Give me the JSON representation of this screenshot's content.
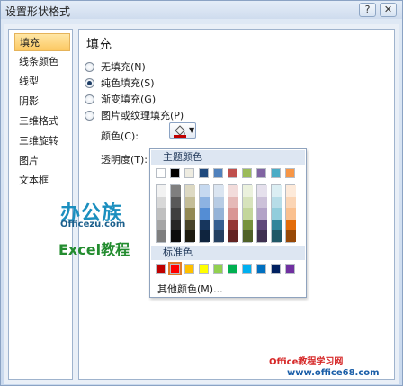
{
  "window": {
    "title": "设置形状格式",
    "help_icon": "?",
    "close_icon": "✕"
  },
  "nav": {
    "items": [
      {
        "label": "填充",
        "active": true
      },
      {
        "label": "线条颜色",
        "active": false
      },
      {
        "label": "线型",
        "active": false
      },
      {
        "label": "阴影",
        "active": false
      },
      {
        "label": "三维格式",
        "active": false
      },
      {
        "label": "三维旋转",
        "active": false
      },
      {
        "label": "图片",
        "active": false
      },
      {
        "label": "文本框",
        "active": false
      }
    ]
  },
  "fill": {
    "section_title": "填充",
    "options": [
      {
        "label": "无填充(N)",
        "selected": false
      },
      {
        "label": "纯色填充(S)",
        "selected": true
      },
      {
        "label": "渐变填充(G)",
        "selected": false
      },
      {
        "label": "图片或纹理填充(P)",
        "selected": false
      }
    ],
    "color_label": "颜色(C):",
    "transparency_label": "透明度(T):",
    "selected_color": "#c00000"
  },
  "palette": {
    "theme_header": "主题颜色",
    "standard_header": "标准色",
    "more_colors": "其他颜色(M)...",
    "theme_colors": [
      "#ffffff",
      "#000000",
      "#eeece1",
      "#1f497d",
      "#4f81bd",
      "#c0504d",
      "#9bbb59",
      "#8064a2",
      "#4bacc6",
      "#f79646"
    ],
    "theme_shades": [
      [
        "#f2f2f2",
        "#d8d8d8",
        "#bfbfbf",
        "#a5a5a5",
        "#7f7f7f"
      ],
      [
        "#7f7f7f",
        "#595959",
        "#3f3f3f",
        "#262626",
        "#0c0c0c"
      ],
      [
        "#ddd9c3",
        "#c4bd97",
        "#938953",
        "#494429",
        "#1d1b10"
      ],
      [
        "#c6d9f0",
        "#8db3e2",
        "#548dd4",
        "#17365d",
        "#0f243e"
      ],
      [
        "#dbe5f1",
        "#b8cce4",
        "#95b3d7",
        "#366092",
        "#244061"
      ],
      [
        "#f2dcdb",
        "#e5b9b7",
        "#d99694",
        "#953734",
        "#632423"
      ],
      [
        "#ebf1dd",
        "#d7e3bc",
        "#c3d69b",
        "#76923c",
        "#4f6128"
      ],
      [
        "#e5e0ec",
        "#ccc1d9",
        "#b2a2c7",
        "#5f497a",
        "#3f3151"
      ],
      [
        "#dbeef3",
        "#b7dde8",
        "#92cddc",
        "#31859b",
        "#205867"
      ],
      [
        "#fdeada",
        "#fbd5b5",
        "#fac08f",
        "#e36c09",
        "#974806"
      ]
    ],
    "standard_colors": [
      "#c00000",
      "#ff0000",
      "#ffc000",
      "#ffff00",
      "#92d050",
      "#00b050",
      "#00b0f0",
      "#0070c0",
      "#002060",
      "#7030a0"
    ],
    "selected_standard_index": 1
  },
  "watermark": {
    "brand": "办公族",
    "site": "Officezu.com",
    "tutorial": "Excel教程",
    "footer_title": "Office教程学习网",
    "footer_url": "www.office68.com"
  }
}
